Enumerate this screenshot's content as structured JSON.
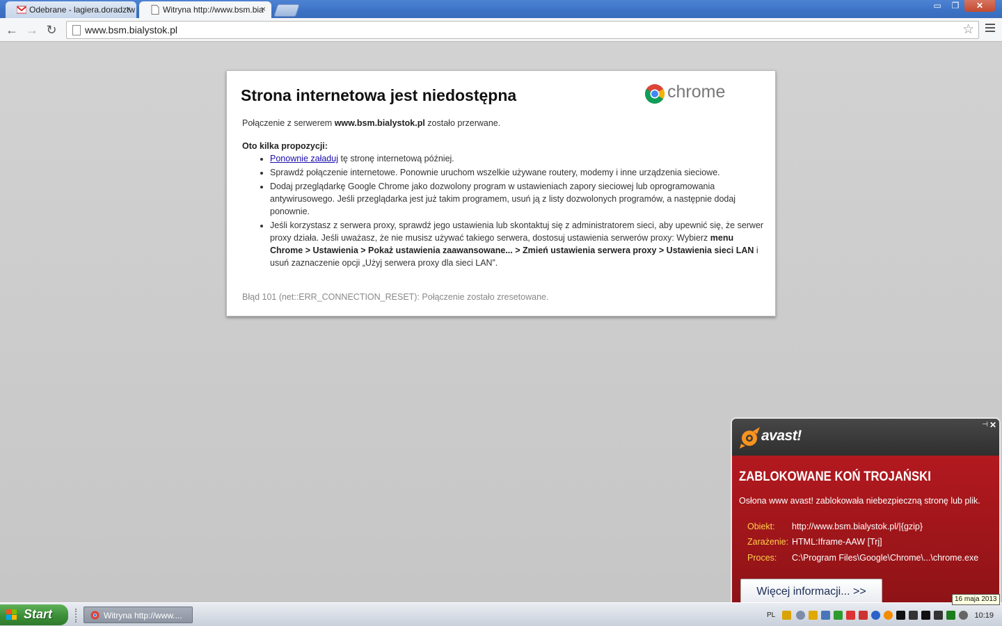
{
  "tabs": [
    {
      "label": "Odebrane - lagiera.doradztw",
      "favicon": "gmail-icon",
      "close": "×"
    },
    {
      "label": "Witryna http://www.bsm.bia",
      "favicon": "page-icon",
      "close": "×"
    }
  ],
  "window_controls": {
    "minimize": "▭",
    "restore": "❐",
    "close": "✕"
  },
  "toolbar": {
    "back": "←",
    "forward": "→",
    "reload": "↻",
    "url": "www.bsm.bialystok.pl",
    "star": "☆"
  },
  "error_page": {
    "title": "Strona internetowa jest niedostępna",
    "brand": "chrome",
    "connection_prefix": "Połączenie z serwerem ",
    "connection_host": "www.bsm.bialystok.pl",
    "connection_suffix": " zostało przerwane.",
    "suggestions_heading": "Oto kilka propozycji:",
    "suggestion1_link": "Ponownie załaduj",
    "suggestion1_rest": " tę stronę internetową później.",
    "suggestion2": "Sprawdź połączenie internetowe. Ponownie uruchom wszelkie używane routery, modemy i inne urządzenia sieciowe.",
    "suggestion3": "Dodaj przeglądarkę Google Chrome jako dozwolony program w ustawieniach zapory sieciowej lub oprogramowania antywirusowego. Jeśli przeglądarka jest już takim programem, usuń ją z listy dozwolonych programów, a następnie dodaj ponownie.",
    "suggestion4_text": "Jeśli korzystasz z serwera proxy, sprawdź jego ustawienia lub skontaktuj się z administratorem sieci, aby upewnić się, że serwer proxy działa. Jeśli uważasz, że nie musisz używać takiego serwera, dostosuj ustawienia serwerów proxy: Wybierz ",
    "suggestion4_bold": "menu Chrome > Ustawienia > Pokaż ustawienia zaawansowane... > Zmień ustawienia serwera proxy > Ustawienia sieci LAN",
    "suggestion4_end": " i usuń zaznaczenie opcji „Użyj serwera proxy dla sieci LAN”.",
    "error_code": "Błąd 101 (net::ERR_CONNECTION_RESET): Połączenie zostało zresetowane."
  },
  "avast": {
    "brand": "avast!",
    "pin": "⊣",
    "close": "✕",
    "title": "ZABLOKOWANE KOŃ TROJAŃSKI",
    "message": "Osłona www avast! zablokowała niebezpieczną stronę lub plik.",
    "object_label": "Obiekt:",
    "object_value": "http://www.bsm.bialystok.pl/|{gzip}",
    "infection_label": "Zarażenie:",
    "infection_value": "HTML:Iframe-AAW [Trj]",
    "process_label": "Proces:",
    "process_value": "C:\\Program Files\\Google\\Chrome\\...\\chrome.exe",
    "button": "Więcej informacji... >>"
  },
  "taskbar": {
    "start": "Start",
    "task_item": "Witryna http://www....",
    "language": "PL",
    "clock": "10:19",
    "date_tooltip": "16 maja 2013"
  },
  "colors": {
    "avast_red": "#a3161b",
    "avast_label": "#ffd04a",
    "start_green": "#3b8f37",
    "titlebar_blue": "#3c72c4"
  }
}
